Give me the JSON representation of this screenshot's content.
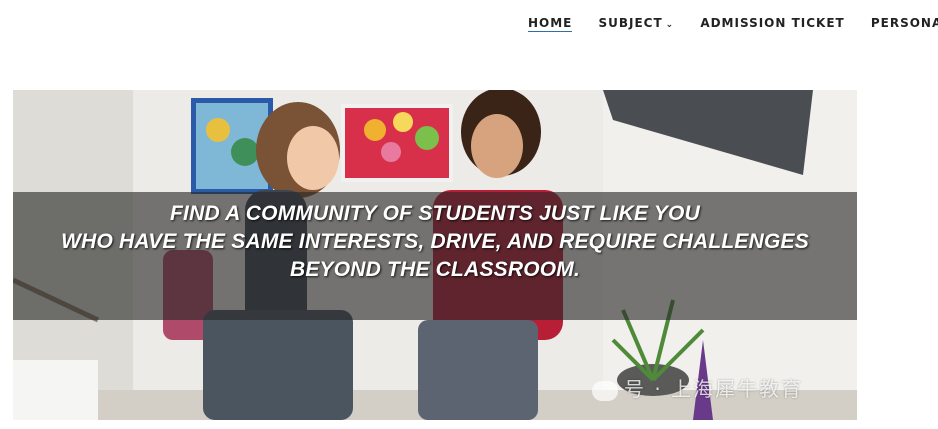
{
  "nav": {
    "items": [
      {
        "label": "HOME",
        "active": true
      },
      {
        "label": "SUBJECT",
        "has_dropdown": true
      },
      {
        "label": "ADMISSION TICKET"
      },
      {
        "label": "PERSONAL CENT"
      }
    ]
  },
  "hero": {
    "lines": [
      "FIND A COMMUNITY OF STUDENTS JUST LIKE YOU",
      "WHO HAVE THE SAME INTERESTS, DRIVE, AND REQUIRE CHALLENGES",
      "BEYOND THE CLASSROOM."
    ]
  },
  "watermark": {
    "text": "号 · 上海犀牛教育"
  },
  "colors": {
    "nav_active_underline": "#2f6fa8",
    "nav_text": "#222222"
  }
}
